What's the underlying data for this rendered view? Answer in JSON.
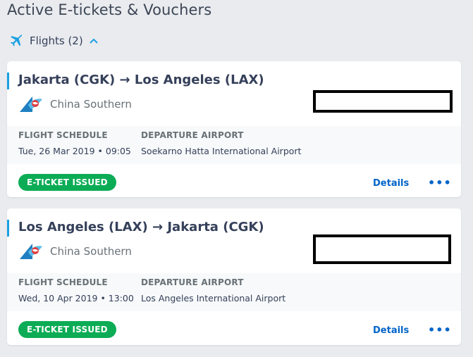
{
  "page": {
    "title": "Active E-tickets & Vouchers"
  },
  "section": {
    "icon": "airplane-icon",
    "label": "Flights (2)",
    "toggle_icon": "chevron-up-icon"
  },
  "colors": {
    "accent": "#1ba0e2",
    "badge_green": "#0bac55",
    "link_blue": "#0264c8",
    "text_dark": "#35405a"
  },
  "bookings": [
    {
      "route": "Jakarta (CGK) → Los Angeles (LAX)",
      "airline": "China Southern",
      "airline_logo": "china-southern-logo-icon",
      "schedule_label": "FLIGHT SCHEDULE",
      "schedule_value": "Tue, 26 Mar 2019 • 09:05",
      "airport_label": "DEPARTURE AIRPORT",
      "airport_value": "Soekarno Hatta International Airport",
      "status": "E-TICKET ISSUED",
      "details_label": "Details",
      "more_label": "•••"
    },
    {
      "route": "Los Angeles (LAX) → Jakarta (CGK)",
      "airline": "China Southern",
      "airline_logo": "china-southern-logo-icon",
      "schedule_label": "FLIGHT SCHEDULE",
      "schedule_value": "Wed, 10 Apr 2019 • 13:00",
      "airport_label": "DEPARTURE AIRPORT",
      "airport_value": "Los Angeles International Airport",
      "status": "E-TICKET ISSUED",
      "details_label": "Details",
      "more_label": "•••"
    }
  ]
}
